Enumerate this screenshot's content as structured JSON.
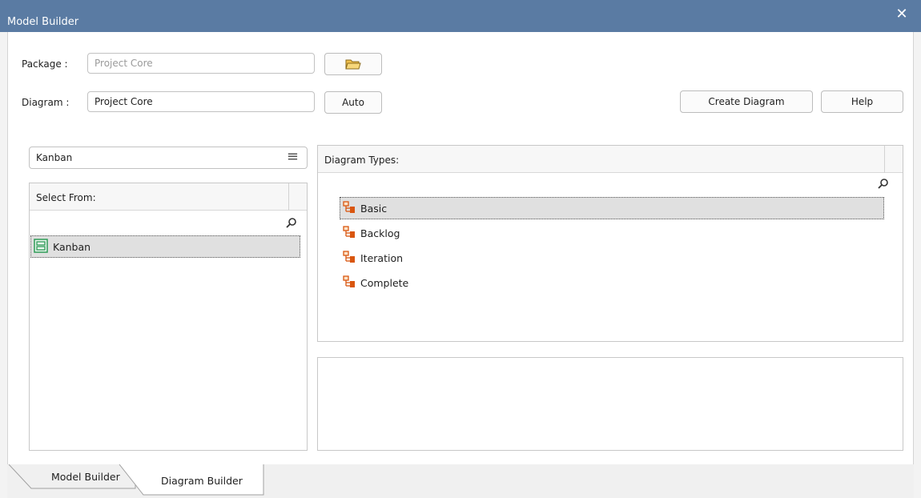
{
  "window": {
    "title": "Model Builder",
    "close_glyph": "✕"
  },
  "package": {
    "label": "Package :",
    "value": "Project Core"
  },
  "diagram": {
    "label": "Diagram :",
    "value": "Project Core",
    "auto_label": "Auto"
  },
  "buttons": {
    "create_diagram": "Create Diagram",
    "help": "Help"
  },
  "category": {
    "value": "Kanban",
    "menu_glyph": "≡"
  },
  "select_from": {
    "header": "Select From:",
    "items": [
      {
        "label": "Kanban",
        "icon": "kanban-model-icon",
        "selected": true
      }
    ]
  },
  "diagram_types": {
    "header": "Diagram Types:",
    "items": [
      {
        "label": "Basic",
        "icon": "diagram-tree-icon",
        "selected": true
      },
      {
        "label": "Backlog",
        "icon": "diagram-tree-icon",
        "selected": false
      },
      {
        "label": "Iteration",
        "icon": "diagram-tree-icon",
        "selected": false
      },
      {
        "label": "Complete",
        "icon": "diagram-tree-icon",
        "selected": false
      }
    ]
  },
  "tabs": [
    {
      "label": "Model Builder",
      "active": false
    },
    {
      "label": "Diagram Builder",
      "active": true
    }
  ],
  "colors": {
    "titlebar": "#5a7ba3",
    "icon_orange": "#d9560f",
    "icon_green": "#2e9b57"
  }
}
